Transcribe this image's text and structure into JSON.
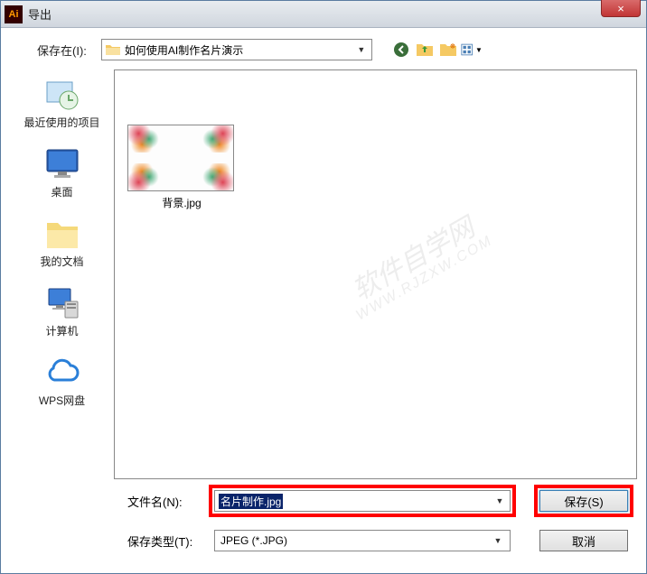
{
  "titlebar": {
    "app_icon_text": "Ai",
    "title": "导出",
    "close_glyph": "×"
  },
  "savein": {
    "label": "保存在(I):",
    "folder_name": "如何使用AI制作名片演示"
  },
  "places": {
    "recent": "最近使用的项目",
    "desktop": "桌面",
    "documents": "我的文档",
    "computer": "计算机",
    "wps": "WPS网盘"
  },
  "file_view": {
    "thumb_name": "背景.jpg"
  },
  "watermark": {
    "line1": "软件自学网",
    "line2": "WWW.RJZXW.COM"
  },
  "bottom": {
    "filename_label": "文件名(N):",
    "filename_value": "名片制作.jpg",
    "filetype_label": "保存类型(T):",
    "filetype_value": "JPEG (*.JPG)",
    "save_btn": "保存(S)",
    "cancel_btn": "取消"
  }
}
